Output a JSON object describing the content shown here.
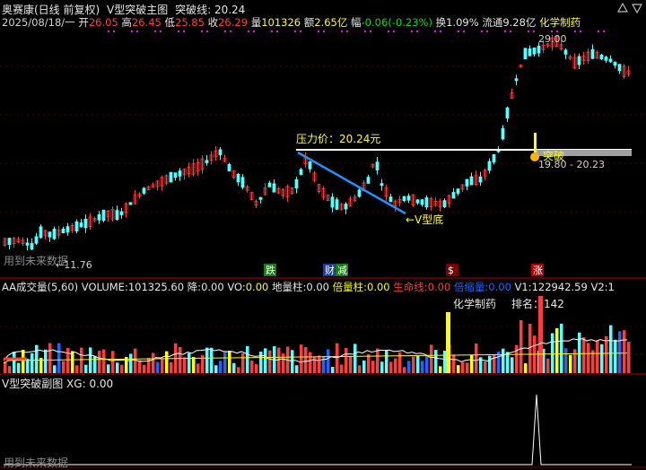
{
  "header": {
    "stock": "奥赛康(日线 前复权)",
    "indicator": "V型突破主图",
    "breakline_label": "突破线:",
    "breakline_value": "20.24",
    "date": "2025/08/18/一",
    "open_label": "开",
    "open": "26.05",
    "high_label": "高",
    "high": "26.45",
    "low_label": "低",
    "low": "25.85",
    "close_label": "收",
    "close": "26.29",
    "vol_label": "量",
    "vol": "101326",
    "amount_label": "额",
    "amount": "2.65亿",
    "change_label": "幅",
    "change": "-0.06(-0.23%)",
    "turnover_label": "换",
    "turnover": "1.09%",
    "float_label": "流通",
    "float": "9.28亿",
    "concept": "化学制药"
  },
  "main_panel": {
    "resistance_label": "压力价：20.24元",
    "vbottom_label": "←V型底",
    "breakout_label": "突破",
    "high_mark": "29.00",
    "low_mark": "←11.76",
    "range_text": "19.80 - 20.23",
    "footer": "用到未来数据",
    "tags": [
      "跌",
      "财",
      "减",
      "$",
      "涨"
    ]
  },
  "volume_panel": {
    "title": "AA成交量(5,60)",
    "volume_label": "VOLUME:",
    "volume": "101325.60",
    "down_label": "降:",
    "down": "0.00",
    "vo_label": "VO:",
    "vo": "0.00",
    "ground_label": "地量柱:",
    "ground": "0.00",
    "double_label": "倍量柱:",
    "double": "0.00",
    "life_label": "生命线:",
    "life": "0.00",
    "shrink_label": "倍缩量:",
    "shrink": "0.00",
    "v1_label": "V1:",
    "v1": "122942.59",
    "v2_label": "V2:",
    "v2": "1",
    "industry": "化学制药",
    "rank_label": "排名：",
    "rank": "142"
  },
  "sub_panel": {
    "title": "V型突破副图",
    "xg_label": "XG:",
    "xg": "0.00",
    "footer": "用到未来数据"
  },
  "colors": {
    "up": "#ff3c3c",
    "down": "#54ffff",
    "yellow": "#ffff00",
    "white": "#ffffff",
    "blue": "#1e64ff",
    "orange": "#ffb400",
    "green": "#00e000"
  }
}
